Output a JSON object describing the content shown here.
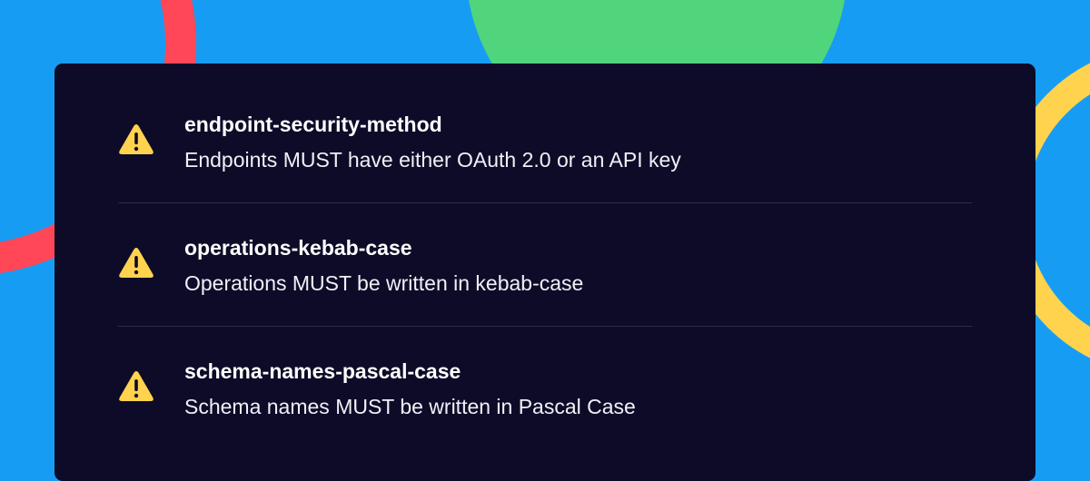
{
  "colors": {
    "background": "#179cf3",
    "panel": "#0d0b28",
    "warning": "#ffd34d",
    "accent_green": "#50d47c",
    "accent_red": "#ff4757",
    "accent_yellow": "#ffd34d"
  },
  "rules": [
    {
      "icon": "warning-triangle-icon",
      "name": "endpoint-security-method",
      "description": "Endpoints MUST have either OAuth 2.0 or an API key"
    },
    {
      "icon": "warning-triangle-icon",
      "name": "operations-kebab-case",
      "description": "Operations MUST be written in kebab-case"
    },
    {
      "icon": "warning-triangle-icon",
      "name": "schema-names-pascal-case",
      "description": "Schema names MUST be written in Pascal Case"
    }
  ]
}
